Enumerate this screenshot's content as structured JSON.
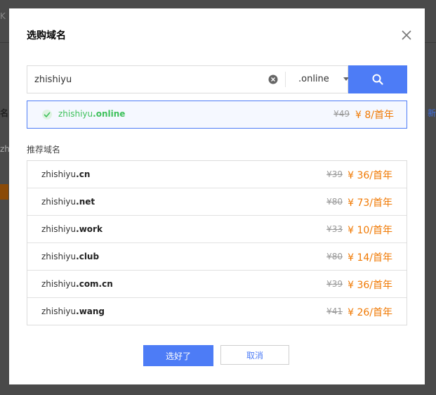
{
  "background": {
    "frag1": "K",
    "frag2": "名",
    "frag3": "zh",
    "frag4": "新"
  },
  "dialog": {
    "title": "选购域名",
    "close_icon": "close-icon"
  },
  "search": {
    "value": "zhishiyu",
    "suffix": ".online",
    "clear_icon": "clear-icon",
    "button_icon": "search-icon"
  },
  "result": {
    "name": "zhishiyu",
    "tld": ".online",
    "original_price": "¥49",
    "price": "¥ 8/首年",
    "status_icon": "check-circle-icon"
  },
  "recommended": {
    "label": "推荐域名",
    "items": [
      {
        "name": "zhishiyu",
        "tld": ".cn",
        "original_price": "¥39",
        "price": "¥ 36/首年"
      },
      {
        "name": "zhishiyu",
        "tld": ".net",
        "original_price": "¥80",
        "price": "¥ 73/首年"
      },
      {
        "name": "zhishiyu",
        "tld": ".work",
        "original_price": "¥33",
        "price": "¥ 10/首年"
      },
      {
        "name": "zhishiyu",
        "tld": ".club",
        "original_price": "¥80",
        "price": "¥ 14/首年"
      },
      {
        "name": "zhishiyu",
        "tld": ".com.cn",
        "original_price": "¥39",
        "price": "¥ 36/首年"
      },
      {
        "name": "zhishiyu",
        "tld": ".wang",
        "original_price": "¥41",
        "price": "¥ 26/首年"
      }
    ]
  },
  "footer": {
    "confirm_label": "选好了",
    "cancel_label": "取消"
  },
  "colors": {
    "accent": "#4d7cf6",
    "price": "#f07a05",
    "success": "#3ec15b",
    "overlay": "#4a4a4a"
  }
}
